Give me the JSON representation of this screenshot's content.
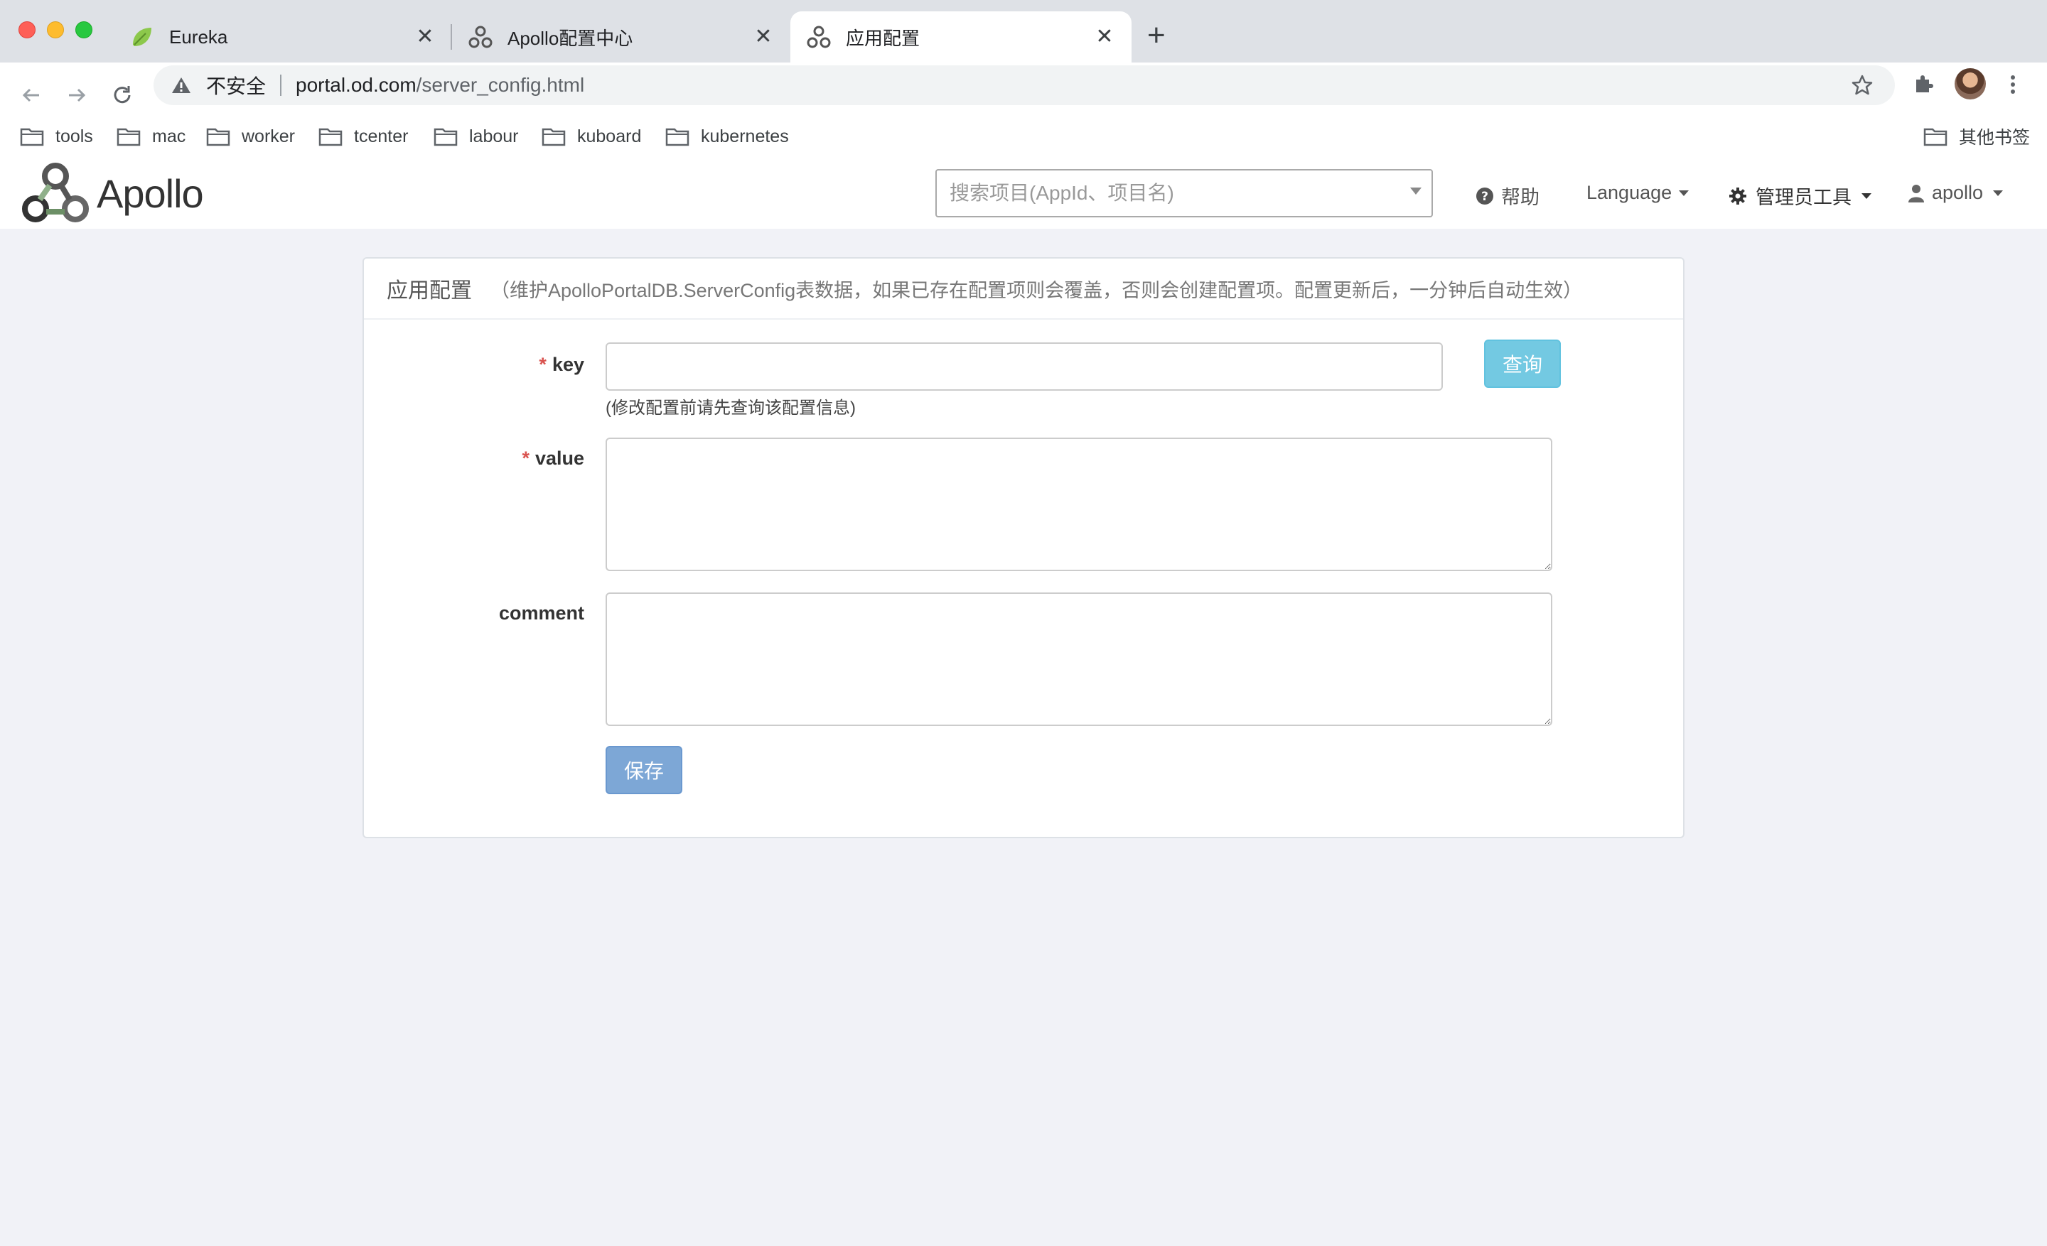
{
  "browser": {
    "tabs": [
      {
        "title": "Eureka",
        "icon": "leaf-icon"
      },
      {
        "title": "Apollo配置中心",
        "icon": "apollo-logo-icon"
      },
      {
        "title": "应用配置",
        "icon": "apollo-logo-icon",
        "active": true
      }
    ],
    "new_tab_label": "+",
    "close_glyph": "✕",
    "address": {
      "security_label": "不安全",
      "host": "portal.od.com",
      "path": "/server_config.html"
    },
    "bookmarks": [
      "tools",
      "mac",
      "worker",
      "tcenter",
      "labour",
      "kuboard",
      "kubernetes"
    ],
    "other_bookmarks": "其他书签"
  },
  "header": {
    "logo_text": "Apollo",
    "search_placeholder": "搜索项目(AppId、项目名)",
    "help": "帮助",
    "language": "Language",
    "admin_tools": "管理员工具",
    "user": "apollo"
  },
  "panel": {
    "title": "应用配置",
    "subtitle": "（维护ApolloPortalDB.ServerConfig表数据，如果已存在配置项则会覆盖，否则会创建配置项。配置更新后，一分钟后自动生效）",
    "key_label": "key",
    "key_value": "",
    "key_hint": "(修改配置前请先查询该配置信息)",
    "value_label": "value",
    "value_value": "",
    "comment_label": "comment",
    "comment_value": "",
    "required_mark": "*",
    "query_button": "查询",
    "save_button": "保存"
  },
  "colors": {
    "query_button": "#5bc0de",
    "save_button": "#7da7d6",
    "required": "#d9534f",
    "page_bg": "#f1f2f7"
  }
}
